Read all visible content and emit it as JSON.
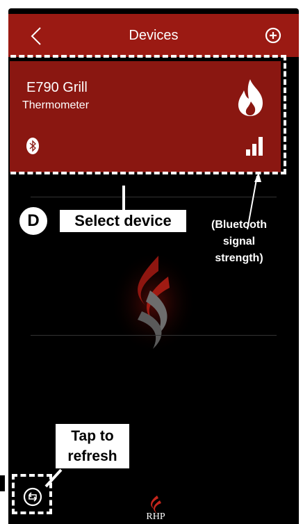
{
  "header": {
    "title": "Devices",
    "back_icon": "chevron-left-icon",
    "add_icon": "plus-circle-icon",
    "bar_color": "#9b1a13"
  },
  "device_card": {
    "name": "E790 Grill",
    "type": "Thermometer",
    "card_color": "#8a1711",
    "flame_icon": "flame-icon",
    "bluetooth_icon": "bluetooth-icon",
    "signal_icon": "signal-strength-icon"
  },
  "annotations": {
    "step_letter": "D",
    "select_device": "Select device",
    "bluetooth_note_line1": "(Bluetooth",
    "bluetooth_note_line2": "signal",
    "bluetooth_note_line3": "strength)",
    "refresh_line1": "Tap to",
    "refresh_line2": "refresh"
  },
  "footer": {
    "refresh_icon": "refresh-icon",
    "logo_text": "RHP"
  }
}
